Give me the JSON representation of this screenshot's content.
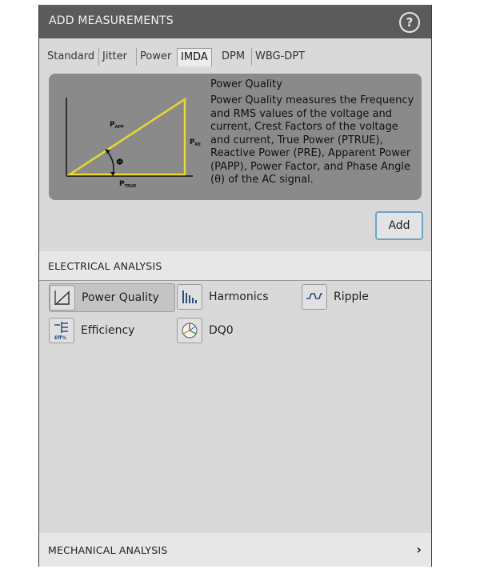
{
  "window": {
    "title": "ADD MEASUREMENTS"
  },
  "tabs": [
    "Standard",
    "Jitter",
    "Power",
    "IMDA",
    "DPM",
    "WBG-DPT"
  ],
  "active_tab": "IMDA",
  "description": {
    "title": "Power Quality",
    "text": "Power Quality measures the Frequency and RMS values of the voltage and current, Crest Factors of the voltage and current, True Power (PTRUE), Reactive Power (PRE), Apparent Power (PAPP), Power Factor, and Phase Angle (θ) of the AC signal.",
    "diagram": {
      "p_app": "P",
      "p_app_sub": "APP",
      "p_re": "P",
      "p_re_sub": "RE",
      "p_true": "P",
      "p_true_sub": "TRUE",
      "angle": "Φ",
      "line_color": "#e8d830"
    }
  },
  "add_button": {
    "label": "Add"
  },
  "electrical": {
    "header": "ELECTRICAL ANALYSIS",
    "items": [
      {
        "label": "Power Quality",
        "icon": "power-quality-icon"
      },
      {
        "label": "Harmonics",
        "icon": "harmonics-icon"
      },
      {
        "label": "Ripple",
        "icon": "ripple-icon"
      },
      {
        "label": "Efficiency",
        "icon": "efficiency-icon",
        "icon_text": "Eff%"
      },
      {
        "label": "DQ0",
        "icon": "dq0-icon"
      }
    ],
    "selected": "Power Quality"
  },
  "mechanical": {
    "header": "MECHANICAL ANALYSIS"
  },
  "colors": {
    "titlebar": "#5b5b5b",
    "panel": "#d9d9d9",
    "add_border": "#6aa5c9"
  }
}
